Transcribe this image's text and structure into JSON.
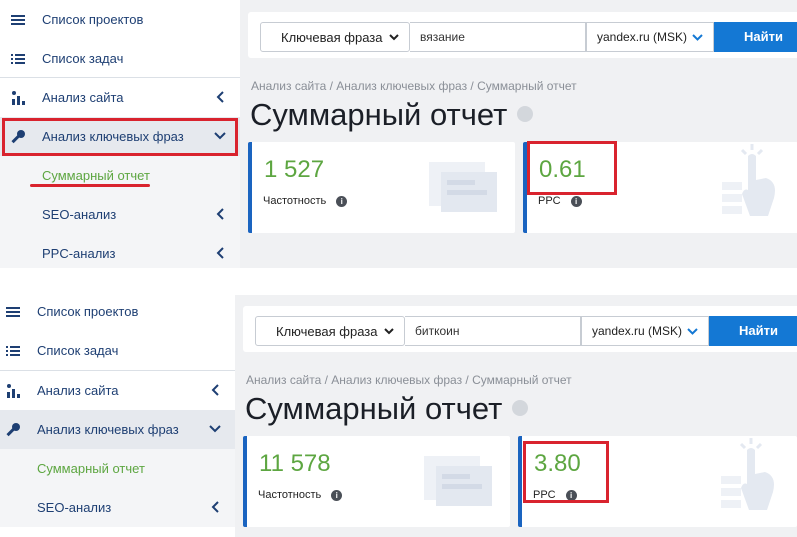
{
  "panels": [
    {
      "sidebar": {
        "items": [
          {
            "label": "Список проектов",
            "icon": "menu-icon"
          },
          {
            "label": "Список задач",
            "icon": "list-icon"
          },
          {
            "label": "Анализ сайта",
            "icon": "site-analysis-icon"
          },
          {
            "label": "Анализ ключевых фраз",
            "icon": "key-icon"
          },
          {
            "label": "Суммарный отчет"
          },
          {
            "label": "SEO-анализ"
          },
          {
            "label": "PPC-анализ"
          }
        ]
      },
      "search": {
        "type_label": "Ключевая фраза",
        "query": "вязание",
        "engine": "yandex.ru (MSK)",
        "button": "Найти"
      },
      "breadcrumb": "Анализ сайта / Анализ ключевых фраз / Суммарный отчет",
      "title": "Суммарный отчет",
      "cards": [
        {
          "value": "1 527",
          "label": "Частотность"
        },
        {
          "value": "0.61",
          "label": "PPC"
        }
      ]
    },
    {
      "sidebar": {
        "items": [
          {
            "label": "Список проектов",
            "icon": "menu-icon"
          },
          {
            "label": "Список задач",
            "icon": "list-icon"
          },
          {
            "label": "Анализ сайта",
            "icon": "site-analysis-icon"
          },
          {
            "label": "Анализ ключевых фраз",
            "icon": "key-icon"
          },
          {
            "label": "Суммарный отчет"
          },
          {
            "label": "SEO-анализ"
          }
        ]
      },
      "search": {
        "type_label": "Ключевая фраза",
        "query": "биткоин",
        "engine": "yandex.ru (MSK)",
        "button": "Найти"
      },
      "breadcrumb": "Анализ сайта / Анализ ключевых фраз / Суммарный отчет",
      "title": "Суммарный отчет",
      "cards": [
        {
          "value": "11 578",
          "label": "Частотность"
        },
        {
          "value": "3.80",
          "label": "PPC"
        }
      ]
    }
  ],
  "colors": {
    "accent": "#1478d4",
    "value_green": "#5da641",
    "highlight_red": "#d9232e",
    "sidebar_text": "#1e3f73"
  }
}
